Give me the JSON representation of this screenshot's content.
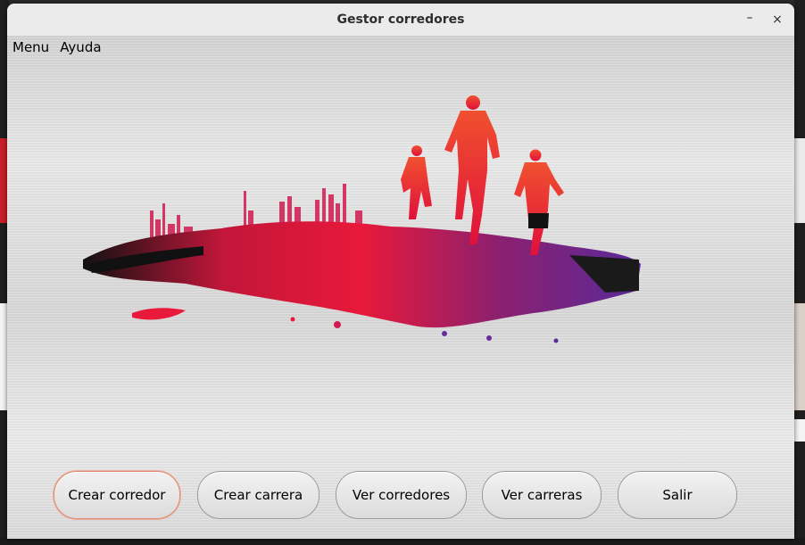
{
  "window": {
    "title": "Gestor corredores",
    "controls": {
      "minimize": "–",
      "close": "×"
    }
  },
  "menubar": {
    "items": [
      "Menu",
      "Ayuda"
    ]
  },
  "image": {
    "description_icon": "runners-city-splash-art"
  },
  "buttons": [
    {
      "label": "Crear corredor",
      "focused": true
    },
    {
      "label": "Crear carrera"
    },
    {
      "label": "Ver corredores"
    },
    {
      "label": "Ver carreras"
    },
    {
      "label": "Salir"
    }
  ],
  "colors": {
    "accent_focus": "#e0876e",
    "splash_red": "#e8193a",
    "splash_purple": "#6a2a9a"
  }
}
